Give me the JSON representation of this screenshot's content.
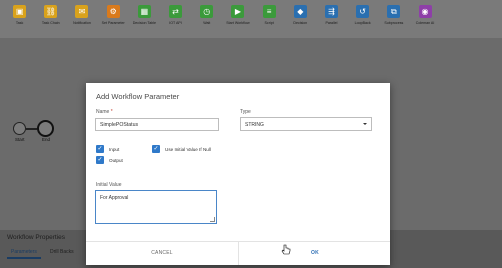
{
  "toolbar": {
    "items": [
      {
        "label": "Task",
        "icon": "task-icon",
        "color": "#d9a21c",
        "glyph": "▣"
      },
      {
        "label": "Task Chain",
        "icon": "task-chain-icon",
        "color": "#d9a21c",
        "glyph": "⛓"
      },
      {
        "label": "Notification",
        "icon": "notification-icon",
        "color": "#d9a21c",
        "glyph": "✉"
      },
      {
        "label": "Set Parameter",
        "icon": "set-parameter-icon",
        "color": "#d97a1c",
        "glyph": "⚙"
      },
      {
        "label": "Decision Table",
        "icon": "decision-table-icon",
        "color": "#3b9a3b",
        "glyph": "▦"
      },
      {
        "label": "IOT API",
        "icon": "iot-api-icon",
        "color": "#3b9a3b",
        "glyph": "⇄"
      },
      {
        "label": "Wait",
        "icon": "wait-icon",
        "color": "#3b9a3b",
        "glyph": "◷"
      },
      {
        "label": "Start Workflow",
        "icon": "start-workflow-icon",
        "color": "#3b9a3b",
        "glyph": "▶"
      },
      {
        "label": "Script",
        "icon": "script-icon",
        "color": "#3b9a3b",
        "glyph": "≡"
      },
      {
        "label": "Decision",
        "icon": "decision-icon",
        "color": "#2a6fb0",
        "glyph": "◆"
      },
      {
        "label": "Parallel",
        "icon": "parallel-icon",
        "color": "#2a6fb0",
        "glyph": "⇶"
      },
      {
        "label": "LoopBack",
        "icon": "loopback-icon",
        "color": "#2a6fb0",
        "glyph": "↺"
      },
      {
        "label": "Subprocess",
        "icon": "subprocess-icon",
        "color": "#2a6fb0",
        "glyph": "⧉"
      },
      {
        "label": "Coleman AI",
        "icon": "coleman-ai-icon",
        "color": "#8e3fa8",
        "glyph": "◉"
      }
    ]
  },
  "canvas": {
    "start_label": "Start",
    "end_label": "End"
  },
  "properties": {
    "title": "Workflow Properties",
    "tabs": [
      "Parameters",
      "Drill Backs"
    ]
  },
  "dialog": {
    "title": "Add Workflow Parameter",
    "name_label": "Name",
    "name_required": "*",
    "name_value": "SimplePOStatus",
    "type_label": "Type",
    "type_value": "STRING",
    "input_label": "Input",
    "output_label": "Output",
    "use_initial_label": "Use Initial Value If Null",
    "initial_value_label": "Initial Value",
    "initial_value": "For Approval",
    "cancel_label": "CANCEL",
    "ok_label": "OK"
  },
  "colors": {
    "accent": "#2f79c9",
    "ok_text": "#2f6fb5"
  }
}
